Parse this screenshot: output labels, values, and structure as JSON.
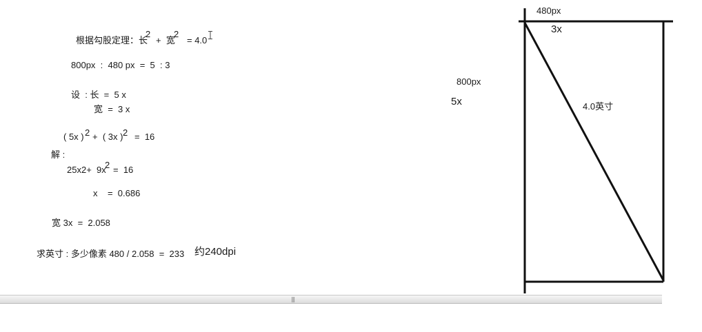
{
  "left_notes": {
    "line1_prefix": "根据勾股定理：长",
    "line1_plus": "+  宽",
    "line1_equals": "= 4.0",
    "sup_two": "2",
    "line2": "800px  :  480 px  =  5  : 3",
    "let_label": "设  : 长  =  5 x",
    "width_label": "宽  =  3 x",
    "equation_left": "( 5x )",
    "equation_plus": "+  ( 3x )",
    "equation_right": "=  16",
    "solve_label": "解 :",
    "solve_eq_a": "25x2+  9x",
    "solve_eq_b": "=  16",
    "x_value": "x    =  0.686",
    "width_result": "宽 3x  =  2.058",
    "ppi_calc": "求英寸 : 多少像素 480 / 2.058  =  233",
    "ppi_result": "约240dpi"
  },
  "diagram": {
    "top_label": "480px",
    "top_ratio": "3x",
    "side_label": "800px",
    "side_ratio": "5x",
    "diagonal_label": "4.0英寸"
  },
  "scrollbar": {
    "grip_glyph": "|||"
  }
}
